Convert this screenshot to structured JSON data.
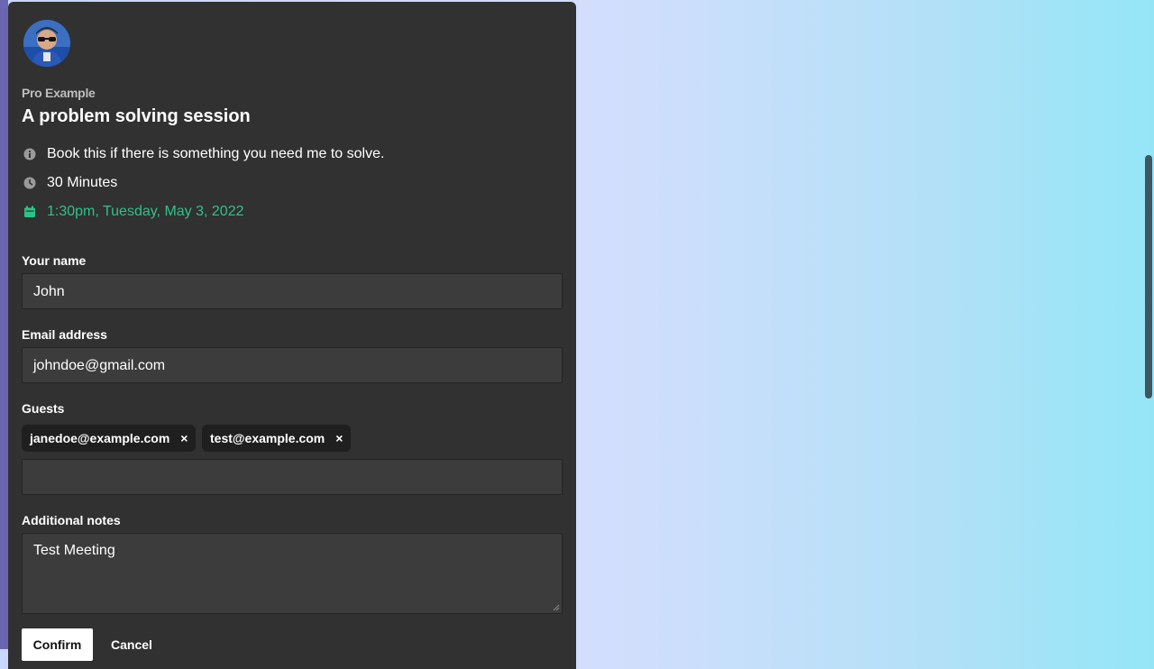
{
  "colors": {
    "card_bg": "#313131",
    "input_bg": "#3c3c3c",
    "accent_green": "#2ec28a",
    "page_gradient_start": "#c9d6fd",
    "page_gradient_end": "#94e6f7"
  },
  "profile": {
    "avatar_icon": "user-avatar",
    "brand": "Pro Example"
  },
  "event": {
    "title": "A problem solving session",
    "description": "Book this if there is something you need me to solve.",
    "duration": "30 Minutes",
    "datetime": "1:30pm, Tuesday, May 3, 2022",
    "icons": {
      "description": "info-icon",
      "duration": "clock-icon",
      "datetime": "calendar-icon"
    }
  },
  "form": {
    "name_label": "Your name",
    "name_value": "John",
    "email_label": "Email address",
    "email_value": "johndoe@gmail.com",
    "guests_label": "Guests",
    "guests": [
      "janedoe@example.com",
      "test@example.com"
    ],
    "guest_remove_glyph": "×",
    "guest_input_value": "",
    "notes_label": "Additional notes",
    "notes_value": "Test Meeting",
    "confirm_label": "Confirm",
    "cancel_label": "Cancel"
  }
}
